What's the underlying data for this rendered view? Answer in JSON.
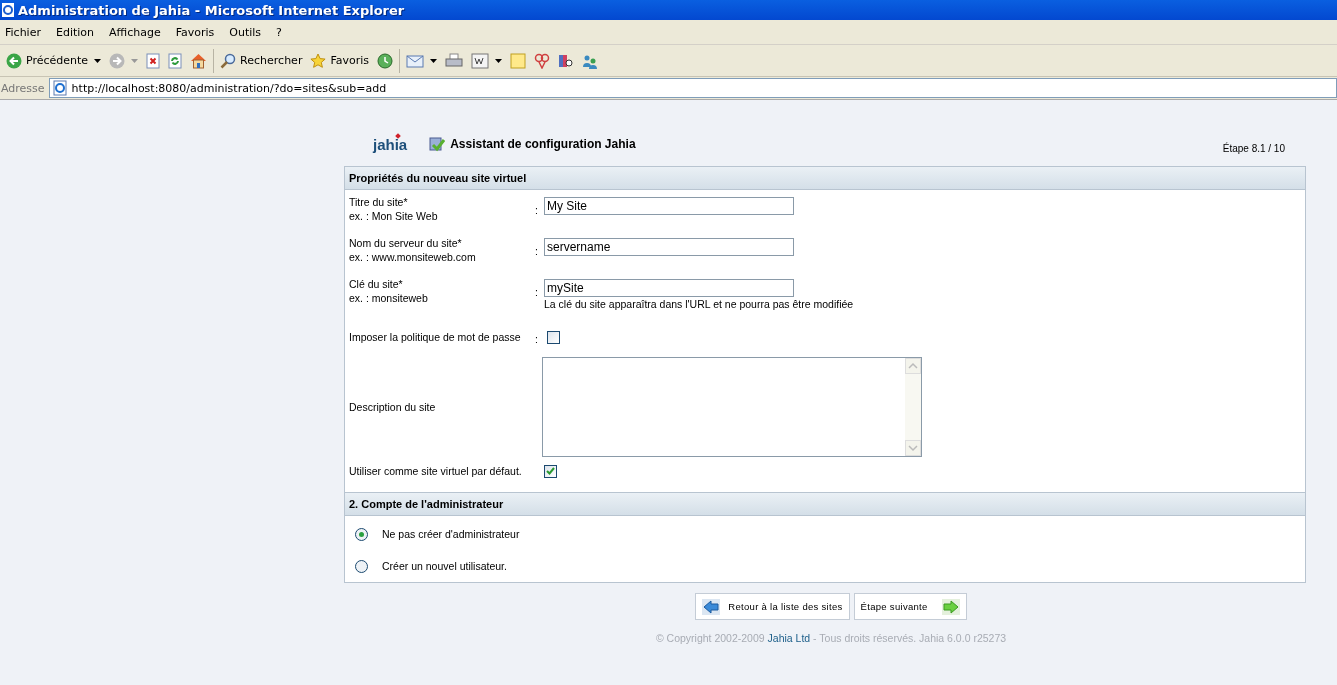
{
  "window": {
    "title": "Administration de Jahia - Microsoft Internet Explorer"
  },
  "menu": [
    "Fichier",
    "Edition",
    "Affichage",
    "Favoris",
    "Outils",
    "?"
  ],
  "toolbar": [
    {
      "kind": "labeled",
      "label": "Précédente",
      "dropdown": true
    },
    {
      "kind": "icon",
      "dropdown": true
    },
    {
      "kind": "icon",
      "dropdown": false
    },
    {
      "kind": "icon",
      "dropdown": false
    },
    {
      "kind": "icon",
      "dropdown": false
    },
    {
      "kind": "labeled",
      "label": "Rechercher",
      "dropdown": false
    },
    {
      "kind": "labeled",
      "label": "Favoris",
      "dropdown": false
    },
    {
      "kind": "icon",
      "dropdown": false
    },
    {
      "kind": "icon",
      "dropdown": true
    },
    {
      "kind": "icon",
      "dropdown": false
    },
    {
      "kind": "icon",
      "dropdown": true
    },
    {
      "kind": "icon",
      "dropdown": false
    },
    {
      "kind": "icon",
      "dropdown": false
    },
    {
      "kind": "icon",
      "dropdown": false
    },
    {
      "kind": "icon",
      "dropdown": false
    }
  ],
  "address": {
    "label": "Adresse",
    "url": "http://localhost:8080/administration/?do=sites&sub=add"
  },
  "page": {
    "logo": "jahia",
    "title": "Assistant de configuration Jahia",
    "step": "Étape 8.1 / 10",
    "sections": [
      {
        "title": "Propriétés du nouveau site virtuel",
        "fields": [
          {
            "kind": "text",
            "label": "Titre du site*",
            "example": "ex. : Mon Site Web",
            "colon": ":",
            "value": "My Site"
          },
          {
            "kind": "text",
            "label": "Nom du serveur du site*",
            "example": "ex. : www.monsiteweb.com",
            "colon": ":",
            "value": "servername"
          },
          {
            "kind": "text",
            "label": "Clé du site*",
            "example": "ex. : monsiteweb",
            "colon": ":",
            "value": "mySite",
            "hint": "La clé du site apparaîtra dans l'URL et ne pourra pas être modifiée"
          },
          {
            "kind": "checkbox",
            "label": "Imposer la politique de mot de passe",
            "colon": ":",
            "checked": false
          },
          {
            "kind": "textarea",
            "label": "Description du site"
          },
          {
            "kind": "checkbox",
            "label": "Utiliser comme site virtuel par défaut.",
            "checked": true
          }
        ]
      },
      {
        "title": "2. Compte de l'administrateur",
        "fields": [
          {
            "kind": "radio",
            "label": "Ne pas créer d'administrateur",
            "selected": true
          },
          {
            "kind": "radio",
            "label": "Créer un nouvel utilisateur.",
            "selected": false
          }
        ]
      }
    ],
    "buttons": [
      {
        "kind": "back",
        "label": "Retour à la liste des sites"
      },
      {
        "kind": "next",
        "label": "Étape suivante"
      }
    ],
    "footer": {
      "before": "© Copyright 2002-2009",
      "link": "Jahia Ltd",
      "after": "- Tous droits réservés. Jahia 6.0.0 r25273"
    }
  }
}
